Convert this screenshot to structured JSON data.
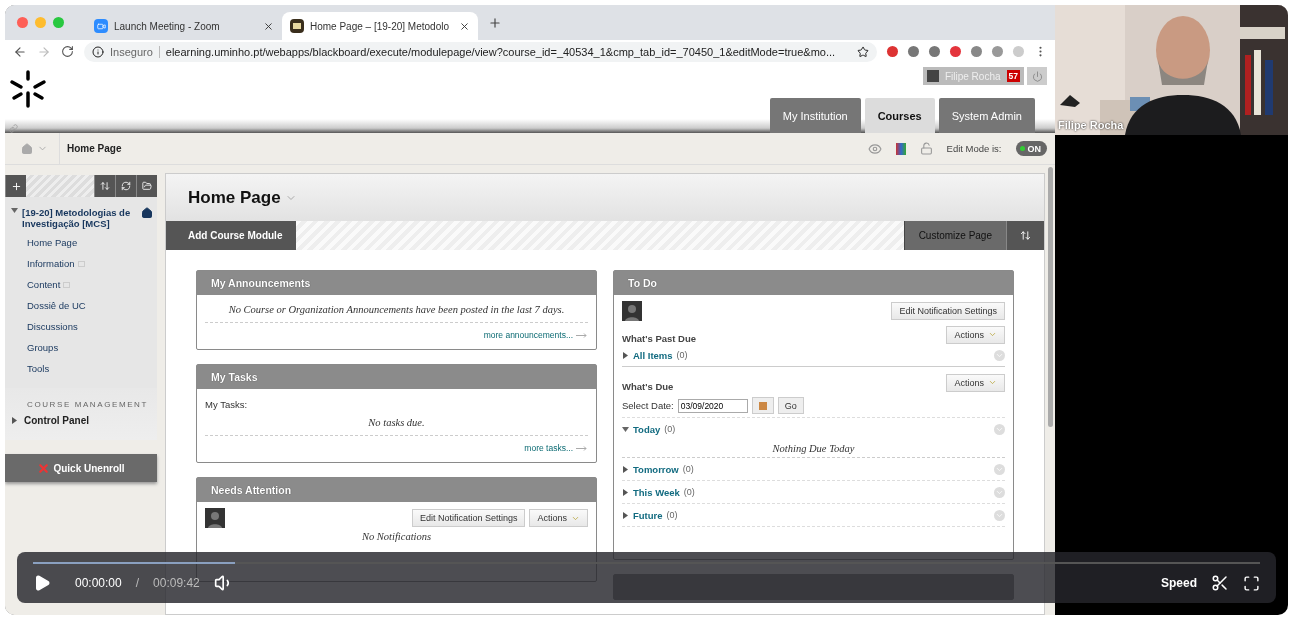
{
  "browser": {
    "tabs": [
      {
        "title": "Launch Meeting - Zoom",
        "kind": "zoom",
        "selected": false
      },
      {
        "title": "Home Page – [19-20] Metodolo",
        "kind": "bb",
        "selected": true
      }
    ],
    "security_label": "Inseguro",
    "url": "elearning.uminho.pt/webapps/blackboard/execute/modulepage/view?course_id=_40534_1&cmp_tab_id=_70450_1&editMode=true&mo..."
  },
  "header": {
    "user_name": "Filipe Rocha",
    "notification_count": "57",
    "tabs": [
      {
        "label": "My Institution",
        "selected": false
      },
      {
        "label": "Courses",
        "selected": true
      },
      {
        "label": "System Admin",
        "selected": false
      }
    ]
  },
  "breadcrumb": {
    "title": "Home Page",
    "edit_mode_label": "Edit Mode is:",
    "edit_mode": {
      "text": "ON",
      "on": true
    }
  },
  "sidebar": {
    "course": {
      "title": "[19-20] Metodologias de Investigação [MCS]",
      "expanded": true
    },
    "items": [
      {
        "label": "Home Page",
        "hidden": false
      },
      {
        "label": "Information",
        "hidden": true
      },
      {
        "label": "Content",
        "hidden": true
      },
      {
        "label": "Dossiê de UC",
        "hidden": false
      },
      {
        "label": "Discussions",
        "hidden": false
      },
      {
        "label": "Groups",
        "hidden": false
      },
      {
        "label": "Tools",
        "hidden": false
      }
    ],
    "section_heading": "COURSE MANAGEMENT",
    "control_panel": {
      "label": "Control Panel",
      "expanded": false
    },
    "quick_unenroll": "Quick Unenroll"
  },
  "page": {
    "title": "Home Page",
    "add_module": "Add Course Module",
    "customize": "Customize Page"
  },
  "announcements": {
    "title": "My Announcements",
    "message": "No Course or Organization Announcements have been posted in the last 7 days.",
    "more": "more announcements..."
  },
  "tasks": {
    "title": "My Tasks",
    "label": "My Tasks:",
    "message": "No tasks due.",
    "more": "more tasks..."
  },
  "needs_attention": {
    "title": "Needs Attention",
    "edit_button": "Edit Notification Settings",
    "actions_button": "Actions",
    "message": "No Notifications"
  },
  "todo": {
    "title": "To Do",
    "edit_button": "Edit Notification Settings",
    "past_due": {
      "heading": "What's Past Due",
      "actions_button": "Actions",
      "groups": [
        {
          "label": "All Items",
          "count": "(0)",
          "expanded": false
        }
      ]
    },
    "due": {
      "heading": "What's Due",
      "date_label": "Select Date:",
      "date_value": "03/09/2020",
      "go_button": "Go",
      "actions_button": "Actions",
      "groups": [
        {
          "label": "Today",
          "count": "(0)",
          "expanded": true,
          "message": "Nothing Due Today"
        },
        {
          "label": "Tomorrow",
          "count": "(0)",
          "expanded": false
        },
        {
          "label": "This Week",
          "count": "(0)",
          "expanded": false
        },
        {
          "label": "Future",
          "count": "(0)",
          "expanded": false
        }
      ]
    }
  },
  "webcam": {
    "name": "Filipe Rocha"
  },
  "player": {
    "current_time": "00:00:00",
    "separator": "/",
    "duration": "00:09:42",
    "speed": "Speed",
    "progress": {
      "level": 0.165
    }
  }
}
